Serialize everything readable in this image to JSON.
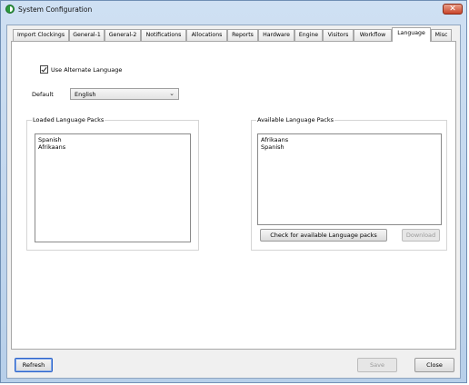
{
  "window": {
    "title": "System Configuration",
    "close_glyph": "✕"
  },
  "tabs": [
    {
      "label": "Import Clockings",
      "active": false
    },
    {
      "label": "General-1",
      "active": false
    },
    {
      "label": "General-2",
      "active": false
    },
    {
      "label": "Notifications",
      "active": false
    },
    {
      "label": "Allocations",
      "active": false
    },
    {
      "label": "Reports",
      "active": false
    },
    {
      "label": "Hardware",
      "active": false
    },
    {
      "label": "Engine",
      "active": false
    },
    {
      "label": "Visitors",
      "active": false
    },
    {
      "label": "Workflow",
      "active": false
    },
    {
      "label": "Language",
      "active": true
    },
    {
      "label": "Misc",
      "active": false
    }
  ],
  "language": {
    "use_alternate_label": "Use Alternate Language",
    "use_alternate_checked": true,
    "default_label": "Default",
    "default_value": "English",
    "loaded_title": "Loaded Language Packs",
    "loaded_items": [
      "Spanish",
      "Afrikaans"
    ],
    "available_title": "Available Language Packs",
    "available_items": [
      "Afrikaans",
      "Spanish"
    ],
    "check_button": "Check for available Language packs",
    "download_button": "Download"
  },
  "footer": {
    "refresh": "Refresh",
    "save": "Save",
    "close": "Close"
  }
}
